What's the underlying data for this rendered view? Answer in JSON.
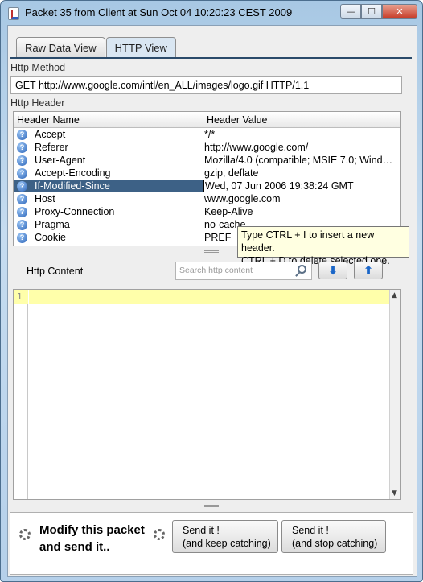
{
  "window": {
    "title": "Packet 35 from Client at Sun Oct 04 10:20:23 CEST 2009",
    "min_symbol": "—",
    "max_symbol": "☐",
    "close_symbol": "✕"
  },
  "tabs": [
    {
      "label": "Raw Data View",
      "active": false
    },
    {
      "label": "HTTP View",
      "active": true
    }
  ],
  "http_method": {
    "label": "Http Method",
    "value": "GET http://www.google.com/intl/en_ALL/images/logo.gif HTTP/1.1"
  },
  "http_header": {
    "label": "Http Header",
    "columns": [
      "Header Name",
      "Header Value"
    ],
    "rows": [
      {
        "name": "Accept",
        "value": "*/*"
      },
      {
        "name": "Referer",
        "value": "http://www.google.com/"
      },
      {
        "name": "User-Agent",
        "value": "Mozilla/4.0 (compatible; MSIE 7.0; Wind…"
      },
      {
        "name": "Accept-Encoding",
        "value": "gzip, deflate"
      },
      {
        "name": "If-Modified-Since",
        "value": "Wed, 07 Jun 2006 19:38:24 GMT",
        "selected": true
      },
      {
        "name": "Host",
        "value": "www.google.com"
      },
      {
        "name": "Proxy-Connection",
        "value": "Keep-Alive"
      },
      {
        "name": "Pragma",
        "value": "no-cache"
      },
      {
        "name": "Cookie",
        "value": "PREF"
      }
    ],
    "tooltip_line1": "Type CTRL + I to insert a new header.",
    "tooltip_line2": "CTRL + D to delete selected one."
  },
  "http_content": {
    "label": "Http Content",
    "search_placeholder": "Search http content",
    "line_number": "1",
    "down_arrow": "⬇",
    "up_arrow": "⬆"
  },
  "footer": {
    "modify_line1": "Modify this packet",
    "modify_line2": "and send it..",
    "send_keep_line1": "Send it !",
    "send_keep_line2": "(and keep catching)",
    "send_stop_line1": "Send it !",
    "send_stop_line2": "(and stop catching)"
  }
}
